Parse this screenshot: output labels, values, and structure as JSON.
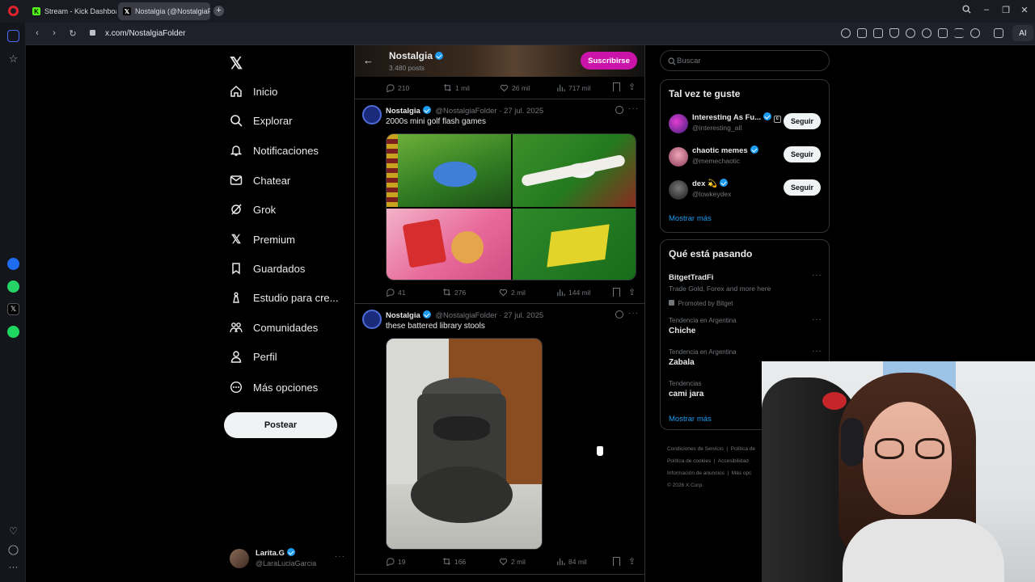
{
  "browser": {
    "tabs": [
      {
        "label": "Stream - Kick Dashboard",
        "icon": "kick-icon"
      },
      {
        "label": "Nostalgia (@NostalgiaFol",
        "icon": "x-logo-icon"
      }
    ],
    "url": "x.com/NostalgiaFolder",
    "ai_label": "AI"
  },
  "sidebar": {
    "items": [
      {
        "label": "Inicio",
        "icon": "home-icon"
      },
      {
        "label": "Explorar",
        "icon": "search-icon"
      },
      {
        "label": "Notificaciones",
        "icon": "bell-icon"
      },
      {
        "label": "Chatear",
        "icon": "mail-icon"
      },
      {
        "label": "Grok",
        "icon": "grok-icon"
      },
      {
        "label": "Premium",
        "icon": "x-premium-icon"
      },
      {
        "label": "Guardados",
        "icon": "bookmark-icon"
      },
      {
        "label": "Estudio para cre...",
        "icon": "studio-icon"
      },
      {
        "label": "Comunidades",
        "icon": "communities-icon"
      },
      {
        "label": "Perfil",
        "icon": "person-icon"
      },
      {
        "label": "Más opciones",
        "icon": "more-circle-icon"
      }
    ],
    "post_button": "Postear",
    "account": {
      "name": "Larita.G",
      "handle": "@LaraLuciaGarcia"
    }
  },
  "profile_header": {
    "name": "Nostalgia",
    "posts": "3.480 posts",
    "subscribe": "Suscribirse"
  },
  "prev_post_actions": {
    "replies": "210",
    "reposts": "1 mil",
    "likes": "26 mil",
    "views": "717 mil"
  },
  "posts": [
    {
      "author": "Nostalgia",
      "handle": "@NostalgiaFolder",
      "date": "27 jul. 2025",
      "text": "2000s mini golf flash games",
      "actions": {
        "replies": "41",
        "reposts": "276",
        "likes": "2 mil",
        "views": "144 mil"
      }
    },
    {
      "author": "Nostalgia",
      "handle": "@NostalgiaFolder",
      "date": "27 jul. 2025",
      "text": "these battered library stools",
      "actions": {
        "replies": "19",
        "reposts": "166",
        "likes": "2 mil",
        "views": "84 mil"
      }
    }
  ],
  "search": {
    "placeholder": "Buscar"
  },
  "who_to_follow": {
    "title": "Tal vez te guste",
    "users": [
      {
        "name": "Interesting As Fu...",
        "handle": "@interesting_aIl",
        "button": "Seguir"
      },
      {
        "name": "chaotic memes",
        "handle": "@memechaotic",
        "button": "Seguir"
      },
      {
        "name": "dex 💫",
        "handle": "@lowkeydex",
        "button": "Seguir"
      }
    ],
    "show_more": "Mostrar más"
  },
  "trending": {
    "title": "Qué está pasando",
    "promoted": {
      "name": "BitgetTradFi",
      "desc": "Trade Gold, Forex and more here",
      "note": "Promoted by Bitget"
    },
    "items": [
      {
        "context": "Tendencia en Argentina",
        "name": "Chiche"
      },
      {
        "context": "Tendencia en Argentina",
        "name": "Zabala"
      },
      {
        "context": "Tendencias",
        "name": "cami jara"
      }
    ],
    "show_more": "Mostrar más"
  },
  "footer": {
    "line1a": "Condiciones de Servicio",
    "line1b": "Política de",
    "line2a": "Política de cookies",
    "line2b": "Accesibilidad",
    "line3a": "Información de anuncios",
    "line3b": "Más opc",
    "line4": "© 2026 X Corp."
  }
}
